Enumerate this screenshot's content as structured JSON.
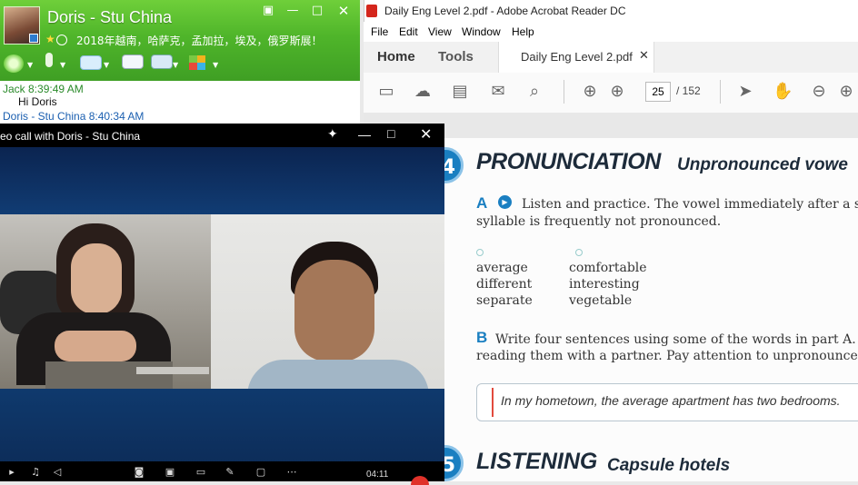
{
  "skype": {
    "contact_name": "Doris - Stu China",
    "mood": "2018年越南，哈萨克，孟加拉，埃及，俄罗斯展！",
    "messages": [
      {
        "sender_time": "Jack  8:39:49 AM",
        "text": "Hi Doris"
      },
      {
        "sender_time": "Doris - Stu China  8:40:34 AM",
        "text": ""
      }
    ],
    "colors": {
      "header_green": "#4fb52a",
      "jack_color": "#2a8a2a",
      "doris_color": "#1b5fb0"
    }
  },
  "video_call": {
    "title": "eo call with Doris - Stu China",
    "timer": "04:11"
  },
  "acrobat": {
    "window_title": "Daily Eng Level 2.pdf - Adobe Acrobat Reader DC",
    "menu": [
      "File",
      "Edit",
      "View",
      "Window",
      "Help"
    ],
    "tabs": {
      "home": "Home",
      "tools": "Tools",
      "doc": "Daily Eng Level 2.pdf"
    },
    "page_current": "25",
    "page_total": "/ 152",
    "page": {
      "section4_number": "4",
      "section4_title": "PRONUNCIATION",
      "section4_subtitle": "Unpronounced vowe",
      "partA_label": "A",
      "partA_line1": "Listen and practice. The vowel immediately after a str",
      "partA_line2": "syllable is frequently not pronounced.",
      "words_col1": [
        "average",
        "different",
        "separate"
      ],
      "words_col2": [
        "comfortable",
        "interesting",
        "vegetable"
      ],
      "partB_label": "B",
      "partB_line1": "Write four sentences using some of the words in part A. The",
      "partB_line2": "reading them with a partner. Pay attention to unpronounced v",
      "example": "In my hometown, the average apartment has two bedrooms.",
      "section5_number": "5",
      "section5_title": "LISTENING",
      "section5_subtitle": "Capsule hotels"
    },
    "colors": {
      "accent_blue": "#1a7fc1",
      "pdf_icon_red": "#d4261c"
    }
  }
}
